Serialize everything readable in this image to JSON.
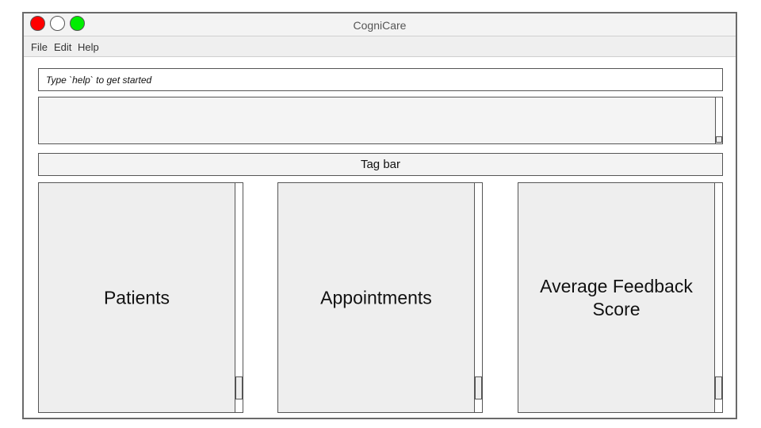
{
  "window": {
    "title": "CogniCare",
    "controls": [
      "close",
      "minimize",
      "maximize"
    ],
    "colors": {
      "close": "#ff0000",
      "minimize": "#ffffff",
      "maximize": "#00ee00"
    }
  },
  "menu": {
    "file": "File",
    "edit": "Edit",
    "help": "Help"
  },
  "command_box": {
    "placeholder": "Type `help` to get started",
    "value": ""
  },
  "result_display": {
    "text": ""
  },
  "tag_bar": {
    "label": "Tag bar"
  },
  "panels": [
    {
      "title": "Patients"
    },
    {
      "title": "Appointments"
    },
    {
      "title": "Average Feedback Score"
    }
  ]
}
